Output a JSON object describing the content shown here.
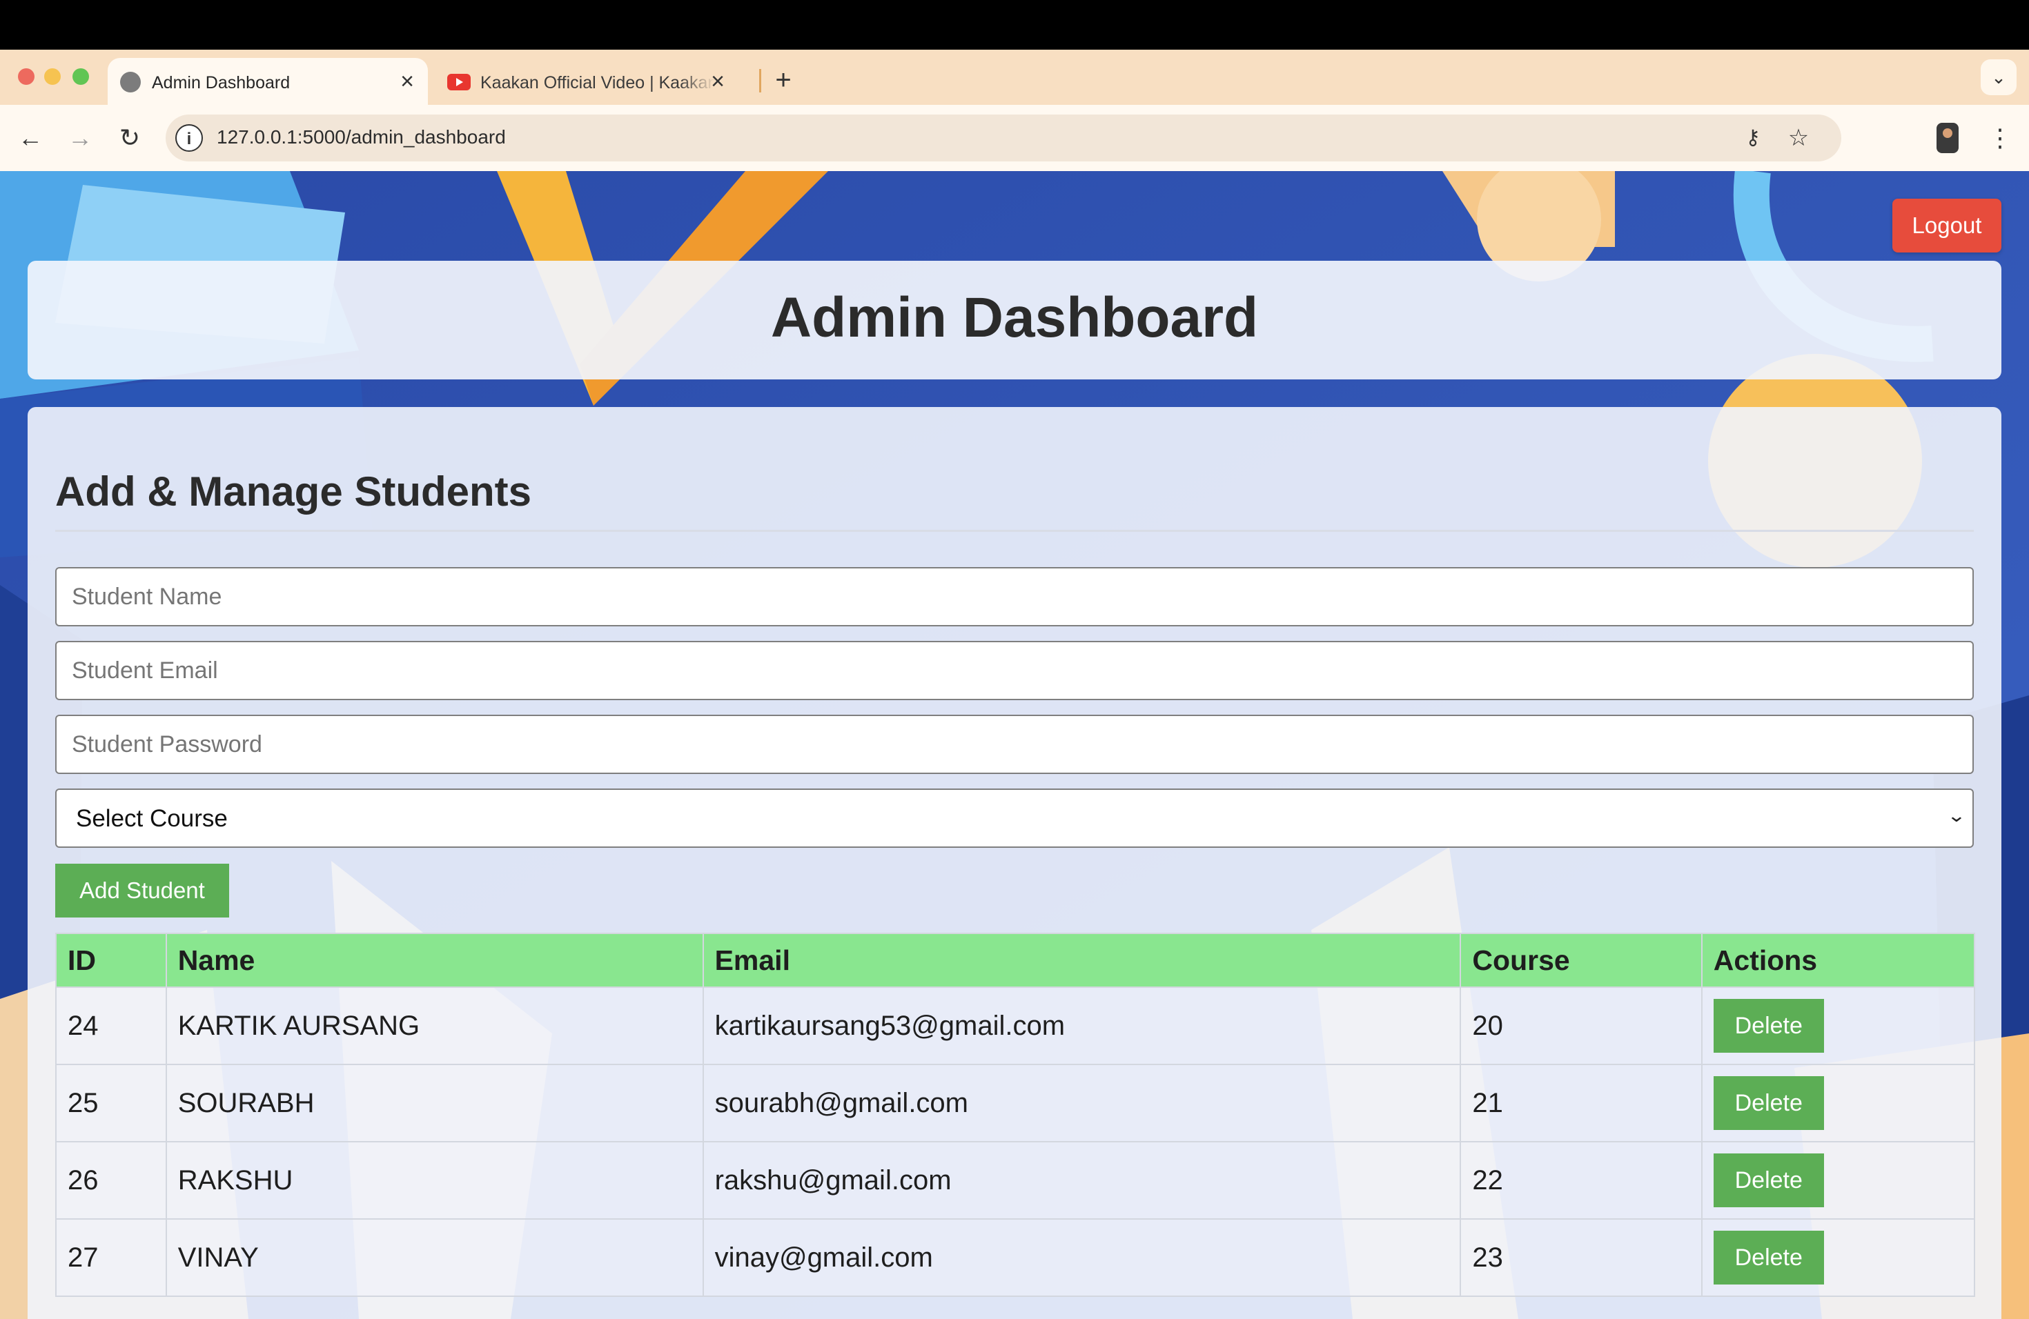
{
  "browser": {
    "tabs": [
      {
        "title": "Admin Dashboard",
        "favicon": "globe-icon",
        "active": true
      },
      {
        "title": "Kaakan Official Video | Kaakan",
        "favicon": "youtube-icon",
        "active": false
      }
    ],
    "new_tab_icon": "+",
    "tab_search_icon": "⌄",
    "close_icon": "×",
    "url": "127.0.0.1:5000/admin_dashboard",
    "nav": {
      "back": "←",
      "forward": "→",
      "reload": "↻",
      "site_info": "i",
      "key": "⚷",
      "star": "☆",
      "menu": "⋮"
    }
  },
  "page": {
    "logout_label": "Logout",
    "title": "Admin Dashboard",
    "section_title": "Add & Manage Students",
    "form": {
      "name_placeholder": "Student Name",
      "email_placeholder": "Student Email",
      "password_placeholder": "Student Password",
      "course_select_value": "Select Course",
      "add_button": "Add Student"
    },
    "table": {
      "headers": {
        "id": "ID",
        "name": "Name",
        "email": "Email",
        "course": "Course",
        "actions": "Actions"
      },
      "rows": [
        {
          "id": "24",
          "name": "KARTIK AURSANG",
          "email": "kartikaursang53@gmail.com",
          "course": "20",
          "action": "Delete"
        },
        {
          "id": "25",
          "name": "SOURABH",
          "email": "sourabh@gmail.com",
          "course": "21",
          "action": "Delete"
        },
        {
          "id": "26",
          "name": "RAKSHU",
          "email": "rakshu@gmail.com",
          "course": "22",
          "action": "Delete"
        },
        {
          "id": "27",
          "name": "VINAY",
          "email": "vinay@gmail.com",
          "course": "23",
          "action": "Delete"
        }
      ]
    }
  },
  "colors": {
    "logout": "#e74c3c",
    "add_button": "#5cae55",
    "table_header": "#89e68f",
    "tab_strip": "#f8dfc2"
  }
}
